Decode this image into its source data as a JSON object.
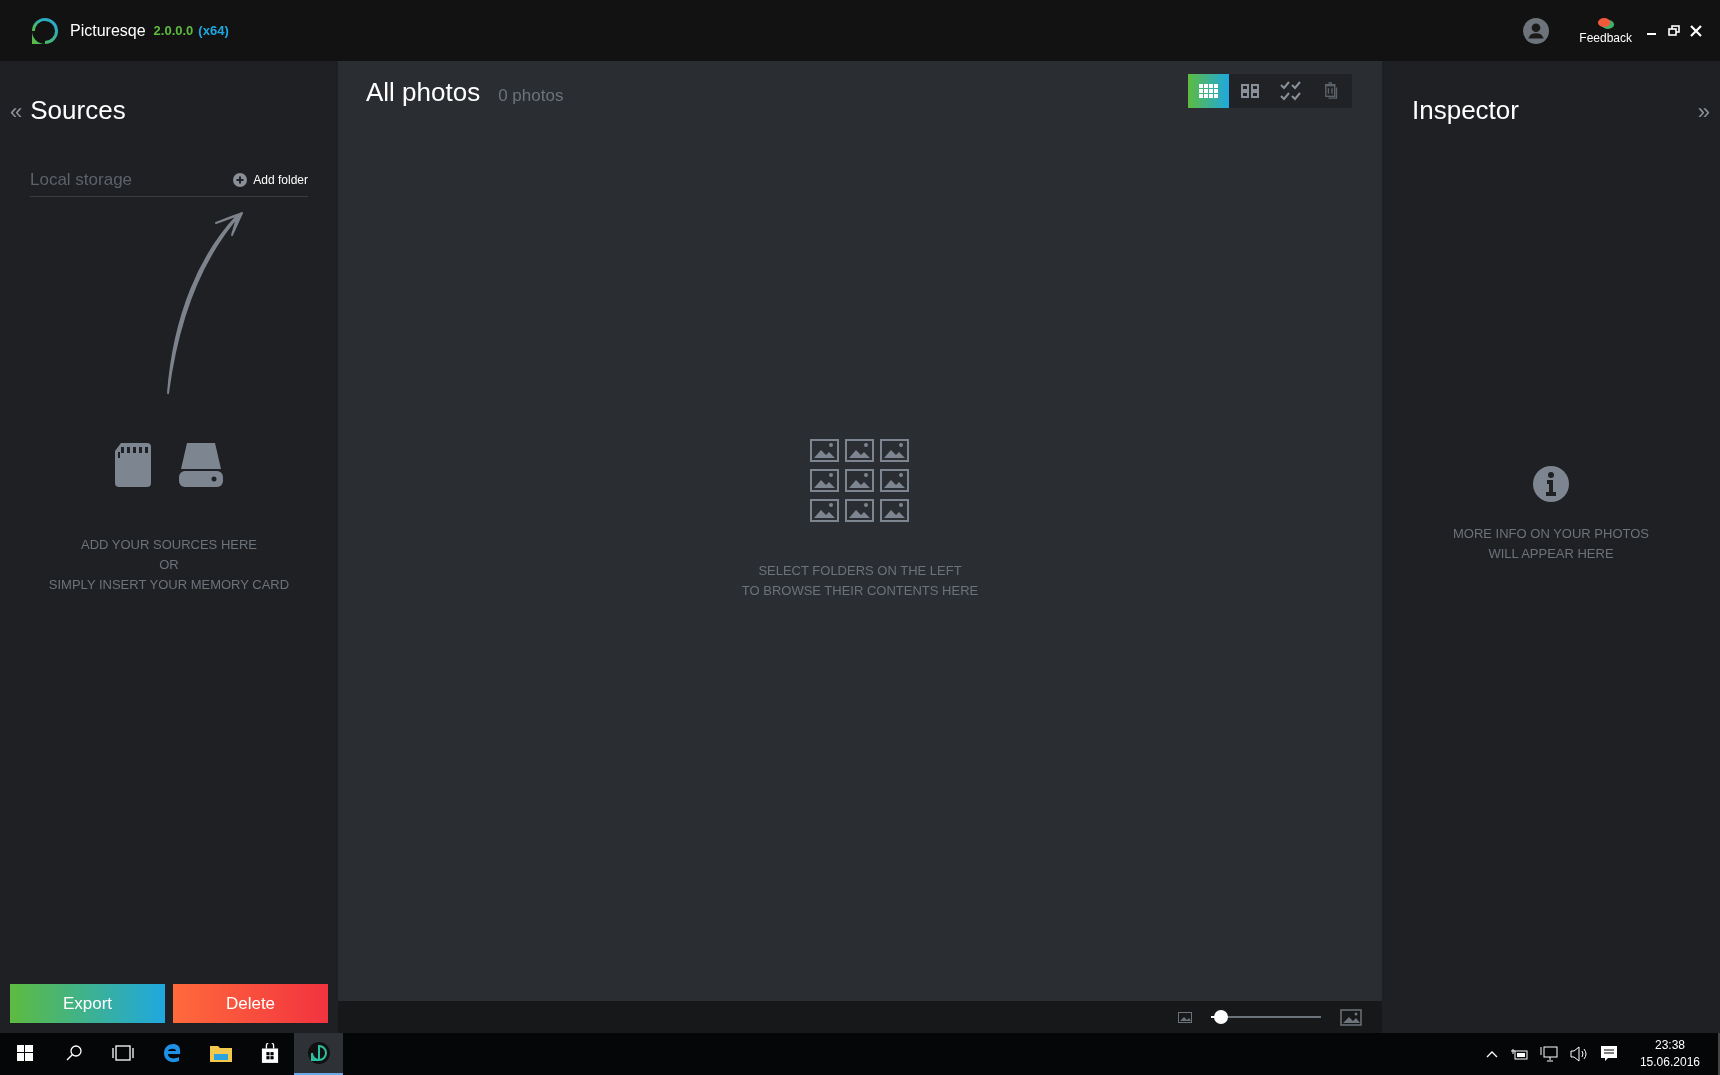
{
  "app": {
    "name": "Picturesqe",
    "version": "2.0.0.0",
    "arch": "(x64)",
    "feedback": "Feedback"
  },
  "sources": {
    "collapse": "«",
    "title": "Sources",
    "storage": {
      "placeholder": "Local storage"
    },
    "add_folder": "Add folder",
    "hint": [
      "ADD YOUR SOURCES HERE",
      "OR",
      "SIMPLY INSERT YOUR MEMORY CARD"
    ],
    "buttons": [
      {
        "label": "Export",
        "kind": "export"
      },
      {
        "label": "Delete",
        "kind": "delete"
      }
    ]
  },
  "main": {
    "title": "All photos",
    "count": "0 photos",
    "view_modes": [
      {
        "kind": "grid",
        "selected": true
      },
      {
        "kind": "tiles",
        "selected": false
      },
      {
        "kind": "select",
        "selected": false
      },
      {
        "kind": "stack",
        "selected": false
      }
    ],
    "empty": [
      "SELECT FOLDERS ON THE LEFT",
      "TO BROWSE THEIR CONTENTS HERE"
    ],
    "zoom": {
      "level": 0.08
    }
  },
  "inspector": {
    "title": "Inspector",
    "expand": "»",
    "empty": [
      "MORE INFO ON YOUR PHOTOS",
      "WILL APPEAR HERE"
    ]
  },
  "taskbar": {
    "items": [
      {
        "kind": "start",
        "selected": false
      },
      {
        "kind": "search",
        "selected": false
      },
      {
        "kind": "taskview",
        "selected": false
      },
      {
        "kind": "browser",
        "selected": false
      },
      {
        "kind": "folder",
        "selected": false
      },
      {
        "kind": "store",
        "selected": false
      },
      {
        "kind": "app",
        "selected": true
      }
    ],
    "time": "23:38",
    "date": "15.06.2016"
  }
}
